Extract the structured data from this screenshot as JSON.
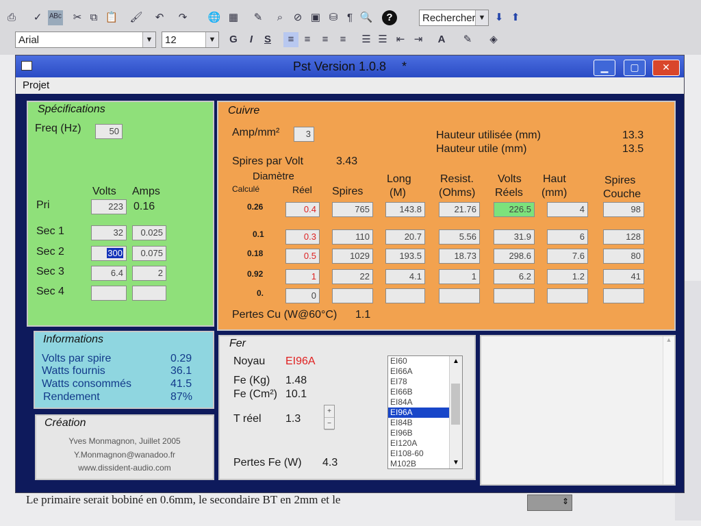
{
  "toolbar": {
    "search_value": "Rechercher",
    "font_name": "Arial",
    "font_size": "12",
    "bold": "G",
    "italic": "I",
    "underline": "S",
    "help": "?"
  },
  "document": {
    "bottom_line": "Le primaire serait bobiné en 0.6mm, le secondaire BT en 2mm et le"
  },
  "window": {
    "title": "Pst Version 1.0.8",
    "title_suffix": "*",
    "menu": "Projet"
  },
  "specs": {
    "title": "Spécifications",
    "freq_label": "Freq (Hz)",
    "freq_value": "50",
    "volts_header": "Volts",
    "amps_header": "Amps",
    "rows": [
      {
        "label": "Pri",
        "volts": "223",
        "amps": "0.16"
      },
      {
        "label": "Sec 1",
        "volts": "32",
        "amps": "0.025"
      },
      {
        "label": "Sec 2",
        "volts": "300",
        "amps": "0.075"
      },
      {
        "label": "Sec 3",
        "volts": "6.4",
        "amps": "2"
      },
      {
        "label": "Sec 4",
        "volts": "",
        "amps": ""
      }
    ]
  },
  "cuivre": {
    "title": "Cuivre",
    "amp_label": "Amp/mm²",
    "amp_value": "3",
    "spires_volt_label": "Spires par Volt",
    "spires_volt_value": "3.43",
    "hauteur_utilisee_label": "Hauteur utilisée (mm)",
    "hauteur_utilisee_value": "13.3",
    "hauteur_utile_label": "Hauteur utile (mm)",
    "hauteur_utile_value": "13.5",
    "headers": {
      "diametre": "Diamètre",
      "calcule": "Calculé",
      "reel": "Réel",
      "spires": "Spires",
      "long": "Long",
      "long_unit": "(M)",
      "resist": "Resist.",
      "resist_unit": "(Ohms)",
      "volts": "Volts",
      "volts_sub": "Réels",
      "haut": "Haut",
      "haut_unit": "(mm)",
      "spires_couche": "Spires",
      "spires_couche_sub": "Couche"
    },
    "rows": [
      {
        "calc": "0.26",
        "reel": "0.4",
        "spires": "765",
        "long": "143.8",
        "resist": "21.76",
        "volts": "226.5",
        "haut": "4",
        "couche": "98"
      },
      {
        "calc": "0.1",
        "reel": "0.3",
        "spires": "110",
        "long": "20.7",
        "resist": "5.56",
        "volts": "31.9",
        "haut": "6",
        "couche": "128"
      },
      {
        "calc": "0.18",
        "reel": "0.5",
        "spires": "1029",
        "long": "193.5",
        "resist": "18.73",
        "volts": "298.6",
        "haut": "7.6",
        "couche": "80"
      },
      {
        "calc": "0.92",
        "reel": "1",
        "spires": "22",
        "long": "4.1",
        "resist": "1",
        "volts": "6.2",
        "haut": "1.2",
        "couche": "41"
      },
      {
        "calc": "0.",
        "reel": "0",
        "spires": "",
        "long": "",
        "resist": "",
        "volts": "",
        "haut": "",
        "couche": ""
      }
    ],
    "pertes_label": "Pertes Cu (W@60°C)",
    "pertes_value": "1.1"
  },
  "informations": {
    "title": "Informations",
    "rows": [
      {
        "label": "Volts par spire",
        "value": "0.29"
      },
      {
        "label": "Watts fournis",
        "value": "36.1"
      },
      {
        "label": "Watts consommés",
        "value": "41.5"
      },
      {
        "label": "Rendement",
        "value": "87%"
      }
    ]
  },
  "creation": {
    "title": "Création",
    "line1": "Yves Monmagnon, Juillet 2005",
    "line2": "Y.Monmagnon@wanadoo.fr",
    "line3": "www.dissident-audio.com"
  },
  "fer": {
    "title": "Fer",
    "noyau_label": "Noyau",
    "noyau_value": "EI96A",
    "fe_kg_label": "Fe (Kg)",
    "fe_kg_value": "1.48",
    "fe_cm_label": "Fe (Cm²)",
    "fe_cm_value": "10.1",
    "t_reel_label": "T réel",
    "t_reel_value": "1.3",
    "pertes_label": "Pertes Fe (W)",
    "pertes_value": "4.3",
    "cores": [
      "EI60",
      "EI66A",
      "EI78",
      "EI66B",
      "EI84A",
      "EI96A",
      "EI84B",
      "EI96B",
      "EI120A",
      "EI108-60",
      "M102B"
    ],
    "selected_core": "EI96A"
  },
  "colors": {
    "spec_bg": "#8fe07a",
    "cuivre_bg": "#f2a24f",
    "info_bg": "#8fd6e0",
    "creation_bg": "#e6e6e6",
    "fer_bg": "#e9e9e9",
    "frame": "#0e1a5c",
    "noyau_red": "#e02020"
  }
}
